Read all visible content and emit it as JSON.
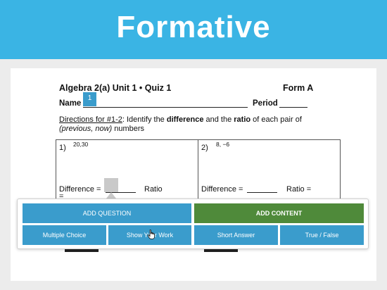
{
  "banner": {
    "title": "Formative"
  },
  "quiz": {
    "title": "Algebra 2(a) Unit 1 • Quiz 1",
    "form": "Form A",
    "name_label": "Name",
    "period_label": "Period",
    "marker": "1",
    "directions": {
      "link": "Directions for #1-2",
      "part1": ": Identify the ",
      "bold1": "difference",
      "part2": " and the ",
      "bold2": "ratio",
      "part3": " of each pair of",
      "italic": "(previous, now)",
      "part4": " numbers"
    },
    "problems": [
      {
        "number": "1)",
        "values": "20,30",
        "difference_label": "Difference =",
        "ratio_label": "Ratio",
        "extra": "="
      },
      {
        "number": "2)",
        "values": "8, −6",
        "difference_label": "Difference =",
        "ratio_label": "Ratio ="
      }
    ]
  },
  "toolbar": {
    "add_question": "ADD QUESTION",
    "add_content": "ADD CONTENT",
    "question_types": [
      "Multiple Choice",
      "Show Your Work",
      "Short Answer",
      "True / False"
    ]
  },
  "colors": {
    "banner": "#3ab4e4",
    "question_button": "#3a9ccc",
    "content_button": "#4f8a3a"
  },
  "icons": {
    "cursor": "hand-pointer-icon"
  }
}
